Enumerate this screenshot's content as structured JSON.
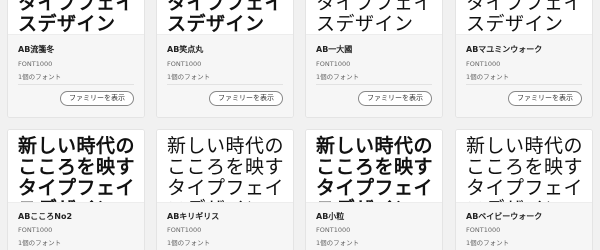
{
  "button_label": "ファミリーを表示",
  "preview_lines": [
    "新しい時代の",
    "こころを映す",
    "タイプフェイ",
    "スデザイン"
  ],
  "cards": [
    {
      "name": "AB流箋冬",
      "publisher": "FONT1000",
      "count": "1個のフォント"
    },
    {
      "name": "AB笑点丸",
      "publisher": "FONT1000",
      "count": "1個のフォント"
    },
    {
      "name": "AB一大國",
      "publisher": "FONT1000",
      "count": "1個のフォント"
    },
    {
      "name": "ABマユミンウォーク",
      "publisher": "FONT1000",
      "count": "1個のフォント"
    },
    {
      "name": "ABこころNo2",
      "publisher": "FONT1000",
      "count": "1個のフォント"
    },
    {
      "name": "ABキリギリス",
      "publisher": "FONT1000",
      "count": "1個のフォント"
    },
    {
      "name": "AB小粒",
      "publisher": "FONT1000",
      "count": "1個のフォント"
    },
    {
      "name": "ABベイビーウォーク",
      "publisher": "FONT1000",
      "count": "1個のフォント"
    }
  ]
}
